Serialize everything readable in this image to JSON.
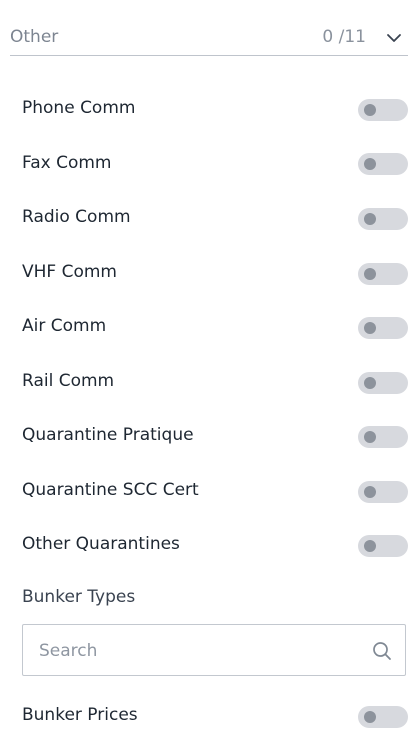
{
  "section": {
    "title": "Other",
    "count": "0 /11"
  },
  "toggles": [
    {
      "label": "Phone Comm",
      "on": false
    },
    {
      "label": "Fax Comm",
      "on": false
    },
    {
      "label": "Radio Comm",
      "on": false
    },
    {
      "label": "VHF Comm",
      "on": false
    },
    {
      "label": "Air Comm",
      "on": false
    },
    {
      "label": "Rail Comm",
      "on": false
    },
    {
      "label": "Quarantine Pratique",
      "on": false
    },
    {
      "label": "Quarantine SCC Cert",
      "on": false
    },
    {
      "label": "Other Quarantines",
      "on": false
    }
  ],
  "bunker_types": {
    "heading": "Bunker Types",
    "search_placeholder": "Search",
    "search_value": ""
  },
  "bunker_prices": {
    "label": "Bunker Prices",
    "on": false
  },
  "icons": {
    "chevron": "chevron-down-icon",
    "search": "search-icon"
  },
  "colors": {
    "toggle_track_off": "#d7d9de",
    "toggle_knob_off": "#8d939c",
    "divider": "#bfc4cc"
  }
}
